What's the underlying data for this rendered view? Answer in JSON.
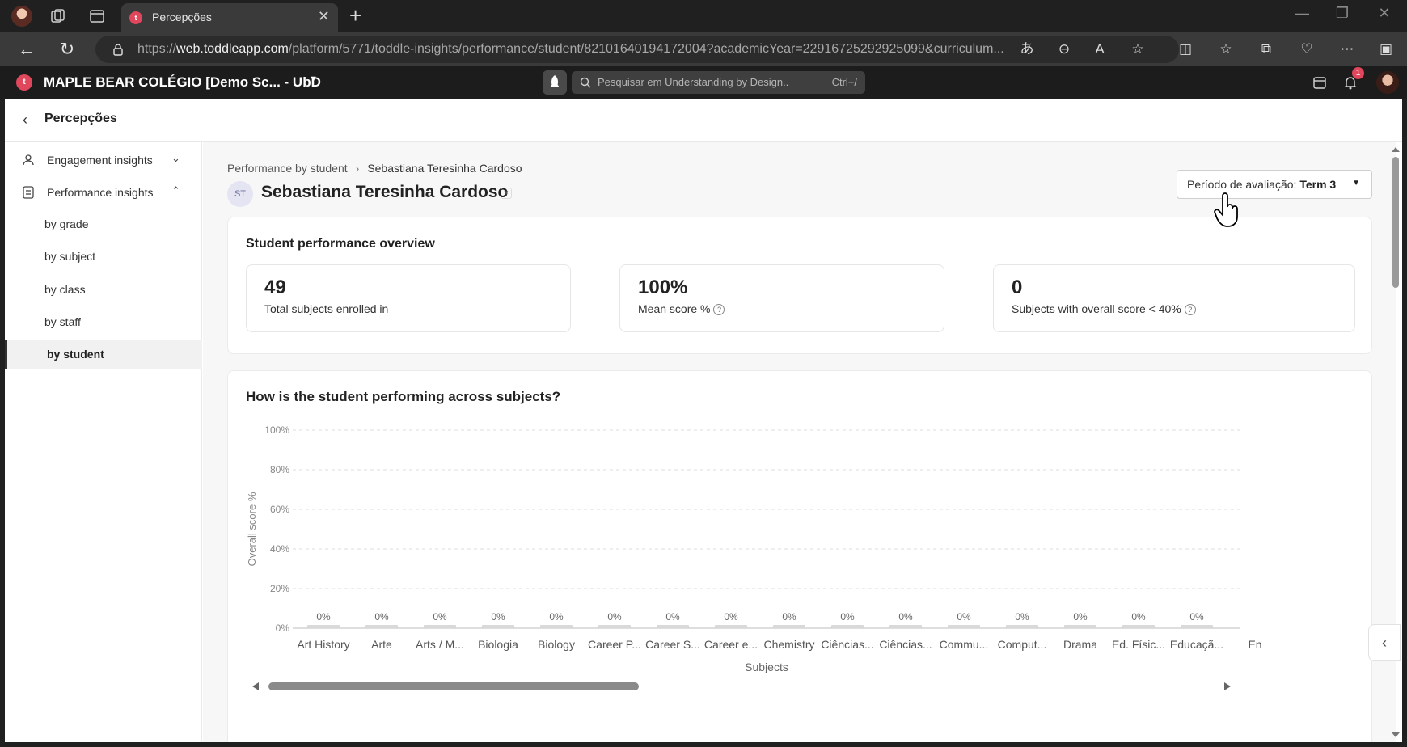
{
  "browser": {
    "tab_title": "Percepções",
    "tab_favicon_letter": "t",
    "url_prefix": "https://",
    "url_host": "web.toddleapp.com",
    "url_path": "/platform/5771/toddle-insights/performance/student/82101640194172004?academicYear=22916725292925099&curriculum..."
  },
  "app_header": {
    "logo_letter": "t",
    "school_name": "MAPLE BEAR COLÉGIO [Demo Sc... - UbD",
    "search_placeholder": "Pesquisar em Understanding by Design..",
    "search_shortcut": "Ctrl+/",
    "notification_count": "1"
  },
  "page": {
    "title": "Percepções"
  },
  "sidebar": {
    "items": [
      {
        "label": "Engagement insights"
      },
      {
        "label": "Performance insights"
      }
    ],
    "sub_items": [
      {
        "label": "by grade"
      },
      {
        "label": "by subject"
      },
      {
        "label": "by class"
      },
      {
        "label": "by staff"
      },
      {
        "label": "by student"
      }
    ]
  },
  "breadcrumb": {
    "parent": "Performance by student",
    "current": "Sebastiana Teresinha Cardoso"
  },
  "student": {
    "initials": "ST",
    "name": "Sebastiana Teresinha Cardoso"
  },
  "period": {
    "label": "Período de avaliação:",
    "value": "Term 3"
  },
  "overview": {
    "title": "Student performance overview",
    "stats": [
      {
        "value": "49",
        "label": "Total subjects enrolled in"
      },
      {
        "value": "100%",
        "label": "Mean score %"
      },
      {
        "value": "0",
        "label": "Subjects with overall score < 40%"
      }
    ]
  },
  "chart_section": {
    "title": "How is the student performing across subjects?"
  },
  "chart_data": {
    "type": "bar",
    "xlabel": "Subjects",
    "ylabel": "Overall score %",
    "ylim": [
      0,
      100
    ],
    "yticks": [
      "0%",
      "20%",
      "40%",
      "60%",
      "80%",
      "100%"
    ],
    "grid": true,
    "categories": [
      "Art History",
      "Arte",
      "Arts / M...",
      "Biologia",
      "Biology",
      "Career P...",
      "Career S...",
      "Career e...",
      "Chemistry",
      "Ciências...",
      "Ciências...",
      "Commu...",
      "Comput...",
      "Drama",
      "Ed. Físic...",
      "Educaçã...",
      "En"
    ],
    "values": [
      0,
      0,
      0,
      0,
      0,
      0,
      0,
      0,
      0,
      0,
      0,
      0,
      0,
      0,
      0,
      0,
      0
    ],
    "data_labels": [
      "0%",
      "0%",
      "0%",
      "0%",
      "0%",
      "0%",
      "0%",
      "0%",
      "0%",
      "0%",
      "0%",
      "0%",
      "0%",
      "0%",
      "0%",
      "0%",
      ""
    ],
    "bar_color": "#d9d9d9"
  },
  "colors": {
    "accent": "#e0465c",
    "header_bg": "#1c1c1c"
  }
}
